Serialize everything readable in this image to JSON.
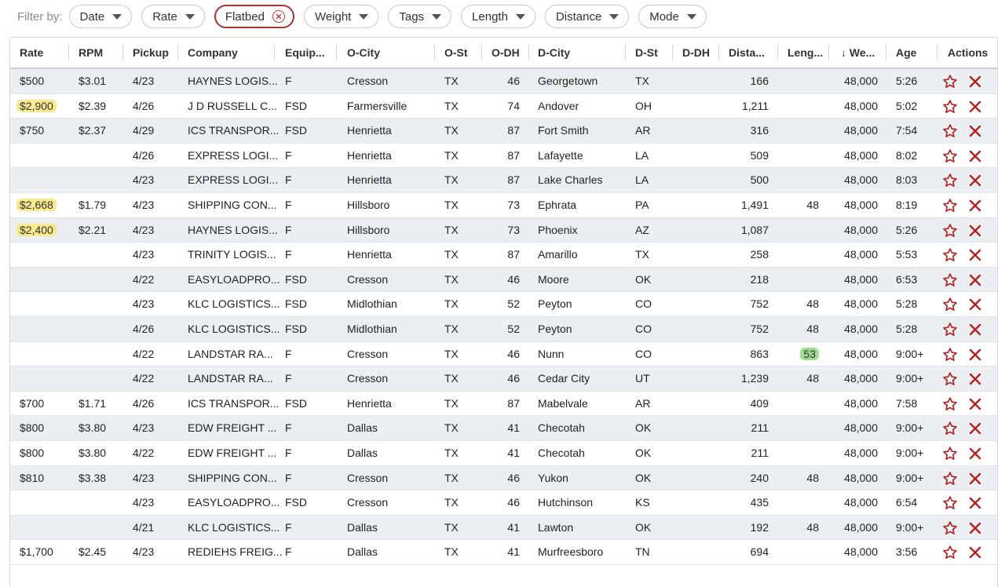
{
  "filter_bar": {
    "label": "Filter by:",
    "chips": [
      {
        "label": "Date",
        "active": false
      },
      {
        "label": "Rate",
        "active": false
      },
      {
        "label": "Flatbed",
        "active": true
      },
      {
        "label": "Weight",
        "active": false
      },
      {
        "label": "Tags",
        "active": false
      },
      {
        "label": "Length",
        "active": false
      },
      {
        "label": "Distance",
        "active": false
      },
      {
        "label": "Mode",
        "active": false
      }
    ]
  },
  "table": {
    "headers": [
      "Rate",
      "RPM",
      "Pickup",
      "Company",
      "Equip...",
      "O-City",
      "O-St",
      "O-DH",
      "D-City",
      "D-St",
      "D-DH",
      "Dista...",
      "Leng...",
      "We...",
      "Age",
      "Actions"
    ],
    "sort_indicator": "↓",
    "rows": [
      {
        "rate": "$500",
        "rpm": "$3.01",
        "pickup": "4/23",
        "company": "HAYNES LOGIS...",
        "equip": "F",
        "ocity": "Cresson",
        "ost": "TX",
        "odh": "46",
        "dcity": "Georgetown",
        "dst": "TX",
        "ddh": "",
        "dist": "166",
        "len": "",
        "wt": "48,000",
        "age": "5:26",
        "rate_hl": false,
        "len_hl": false
      },
      {
        "rate": "$2,900",
        "rpm": "$2.39",
        "pickup": "4/26",
        "company": "J D RUSSELL C...",
        "equip": "FSD",
        "ocity": "Farmersville",
        "ost": "TX",
        "odh": "74",
        "dcity": "Andover",
        "dst": "OH",
        "ddh": "",
        "dist": "1,211",
        "len": "",
        "wt": "48,000",
        "age": "5:02",
        "rate_hl": true,
        "len_hl": false
      },
      {
        "rate": "$750",
        "rpm": "$2.37",
        "pickup": "4/29",
        "company": "ICS TRANSPOR...",
        "equip": "FSD",
        "ocity": "Henrietta",
        "ost": "TX",
        "odh": "87",
        "dcity": "Fort Smith",
        "dst": "AR",
        "ddh": "",
        "dist": "316",
        "len": "",
        "wt": "48,000",
        "age": "7:54",
        "rate_hl": false,
        "len_hl": false
      },
      {
        "rate": "",
        "rpm": "",
        "pickup": "4/26",
        "company": "EXPRESS LOGI...",
        "equip": "F",
        "ocity": "Henrietta",
        "ost": "TX",
        "odh": "87",
        "dcity": "Lafayette",
        "dst": "LA",
        "ddh": "",
        "dist": "509",
        "len": "",
        "wt": "48,000",
        "age": "8:02",
        "rate_hl": false,
        "len_hl": false
      },
      {
        "rate": "",
        "rpm": "",
        "pickup": "4/23",
        "company": "EXPRESS LOGI...",
        "equip": "F",
        "ocity": "Henrietta",
        "ost": "TX",
        "odh": "87",
        "dcity": "Lake Charles",
        "dst": "LA",
        "ddh": "",
        "dist": "500",
        "len": "",
        "wt": "48,000",
        "age": "8:03",
        "rate_hl": false,
        "len_hl": false
      },
      {
        "rate": "$2,668",
        "rpm": "$1.79",
        "pickup": "4/23",
        "company": "SHIPPING CON...",
        "equip": "F",
        "ocity": "Hillsboro",
        "ost": "TX",
        "odh": "73",
        "dcity": "Ephrata",
        "dst": "PA",
        "ddh": "",
        "dist": "1,491",
        "len": "48",
        "wt": "48,000",
        "age": "8:19",
        "rate_hl": true,
        "len_hl": false
      },
      {
        "rate": "$2,400",
        "rpm": "$2.21",
        "pickup": "4/23",
        "company": "HAYNES LOGIS...",
        "equip": "F",
        "ocity": "Hillsboro",
        "ost": "TX",
        "odh": "73",
        "dcity": "Phoenix",
        "dst": "AZ",
        "ddh": "",
        "dist": "1,087",
        "len": "",
        "wt": "48,000",
        "age": "5:26",
        "rate_hl": true,
        "len_hl": false
      },
      {
        "rate": "",
        "rpm": "",
        "pickup": "4/23",
        "company": "TRINITY LOGIS...",
        "equip": "F",
        "ocity": "Henrietta",
        "ost": "TX",
        "odh": "87",
        "dcity": "Amarillo",
        "dst": "TX",
        "ddh": "",
        "dist": "258",
        "len": "",
        "wt": "48,000",
        "age": "5:53",
        "rate_hl": false,
        "len_hl": false
      },
      {
        "rate": "",
        "rpm": "",
        "pickup": "4/22",
        "company": "EASYLOADPRO...",
        "equip": "FSD",
        "ocity": "Cresson",
        "ost": "TX",
        "odh": "46",
        "dcity": "Moore",
        "dst": "OK",
        "ddh": "",
        "dist": "218",
        "len": "",
        "wt": "48,000",
        "age": "6:53",
        "rate_hl": false,
        "len_hl": false
      },
      {
        "rate": "",
        "rpm": "",
        "pickup": "4/23",
        "company": "KLC LOGISTICS...",
        "equip": "FSD",
        "ocity": "Midlothian",
        "ost": "TX",
        "odh": "52",
        "dcity": "Peyton",
        "dst": "CO",
        "ddh": "",
        "dist": "752",
        "len": "48",
        "wt": "48,000",
        "age": "5:28",
        "rate_hl": false,
        "len_hl": false
      },
      {
        "rate": "",
        "rpm": "",
        "pickup": "4/26",
        "company": "KLC LOGISTICS...",
        "equip": "FSD",
        "ocity": "Midlothian",
        "ost": "TX",
        "odh": "52",
        "dcity": "Peyton",
        "dst": "CO",
        "ddh": "",
        "dist": "752",
        "len": "48",
        "wt": "48,000",
        "age": "5:28",
        "rate_hl": false,
        "len_hl": false
      },
      {
        "rate": "",
        "rpm": "",
        "pickup": "4/22",
        "company": "LANDSTAR RA...",
        "equip": "F",
        "ocity": "Cresson",
        "ost": "TX",
        "odh": "46",
        "dcity": "Nunn",
        "dst": "CO",
        "ddh": "",
        "dist": "863",
        "len": "53",
        "wt": "48,000",
        "age": "9:00+",
        "rate_hl": false,
        "len_hl": true
      },
      {
        "rate": "",
        "rpm": "",
        "pickup": "4/22",
        "company": "LANDSTAR RA...",
        "equip": "F",
        "ocity": "Cresson",
        "ost": "TX",
        "odh": "46",
        "dcity": "Cedar City",
        "dst": "UT",
        "ddh": "",
        "dist": "1,239",
        "len": "48",
        "wt": "48,000",
        "age": "9:00+",
        "rate_hl": false,
        "len_hl": false
      },
      {
        "rate": "$700",
        "rpm": "$1.71",
        "pickup": "4/26",
        "company": "ICS TRANSPOR...",
        "equip": "FSD",
        "ocity": "Henrietta",
        "ost": "TX",
        "odh": "87",
        "dcity": "Mabelvale",
        "dst": "AR",
        "ddh": "",
        "dist": "409",
        "len": "",
        "wt": "48,000",
        "age": "7:58",
        "rate_hl": false,
        "len_hl": false
      },
      {
        "rate": "$800",
        "rpm": "$3.80",
        "pickup": "4/23",
        "company": "EDW FREIGHT ...",
        "equip": "F",
        "ocity": "Dallas",
        "ost": "TX",
        "odh": "41",
        "dcity": "Checotah",
        "dst": "OK",
        "ddh": "",
        "dist": "211",
        "len": "",
        "wt": "48,000",
        "age": "9:00+",
        "rate_hl": false,
        "len_hl": false
      },
      {
        "rate": "$800",
        "rpm": "$3.80",
        "pickup": "4/22",
        "company": "EDW FREIGHT ...",
        "equip": "F",
        "ocity": "Dallas",
        "ost": "TX",
        "odh": "41",
        "dcity": "Checotah",
        "dst": "OK",
        "ddh": "",
        "dist": "211",
        "len": "",
        "wt": "48,000",
        "age": "9:00+",
        "rate_hl": false,
        "len_hl": false
      },
      {
        "rate": "$810",
        "rpm": "$3.38",
        "pickup": "4/23",
        "company": "SHIPPING CON...",
        "equip": "F",
        "ocity": "Cresson",
        "ost": "TX",
        "odh": "46",
        "dcity": "Yukon",
        "dst": "OK",
        "ddh": "",
        "dist": "240",
        "len": "48",
        "wt": "48,000",
        "age": "9:00+",
        "rate_hl": false,
        "len_hl": false
      },
      {
        "rate": "",
        "rpm": "",
        "pickup": "4/23",
        "company": "EASYLOADPRO...",
        "equip": "FSD",
        "ocity": "Cresson",
        "ost": "TX",
        "odh": "46",
        "dcity": "Hutchinson",
        "dst": "KS",
        "ddh": "",
        "dist": "435",
        "len": "",
        "wt": "48,000",
        "age": "6:54",
        "rate_hl": false,
        "len_hl": false
      },
      {
        "rate": "",
        "rpm": "",
        "pickup": "4/21",
        "company": "KLC LOGISTICS...",
        "equip": "F",
        "ocity": "Dallas",
        "ost": "TX",
        "odh": "41",
        "dcity": "Lawton",
        "dst": "OK",
        "ddh": "",
        "dist": "192",
        "len": "48",
        "wt": "48,000",
        "age": "9:00+",
        "rate_hl": false,
        "len_hl": false
      },
      {
        "rate": "$1,700",
        "rpm": "$2.45",
        "pickup": "4/23",
        "company": "REDIEHS FREIG...",
        "equip": "F",
        "ocity": "Dallas",
        "ost": "TX",
        "odh": "41",
        "dcity": "Murfreesboro",
        "dst": "TN",
        "ddh": "",
        "dist": "694",
        "len": "",
        "wt": "48,000",
        "age": "3:56",
        "rate_hl": false,
        "len_hl": false
      }
    ]
  },
  "icons": {
    "star": "star-icon",
    "remove": "close-icon",
    "chip_remove": "close-circle-icon",
    "dropdown": "chevron-down-icon",
    "sort": "sort-down-icon"
  },
  "colors": {
    "accent": "#b22222",
    "highlight_yellow": "#f7e98c",
    "highlight_green": "#9fdc8e",
    "row_shade": "#eceff1"
  }
}
